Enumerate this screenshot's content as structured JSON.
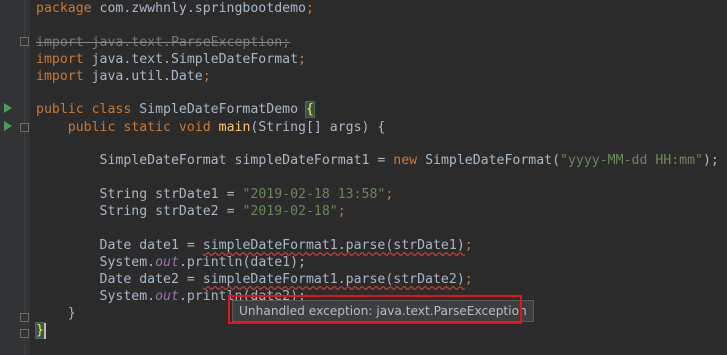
{
  "editor": {
    "lines": {
      "pkg": {
        "kw": "package",
        "name": " com.zwwhnly.springbootdemo",
        "semi": ";"
      },
      "imp1": {
        "kw": "import",
        "name": " java.text.ParseException",
        "semi": ";"
      },
      "imp2": {
        "kw": "import",
        "name": " java.text.SimpleDateFormat",
        "semi": ";"
      },
      "imp3": {
        "kw": "import",
        "name": " java.util.Date",
        "semi": ";"
      },
      "cls": {
        "kw1": "public",
        "kw2": " class ",
        "name": "SimpleDateFormatDemo ",
        "brace": "{"
      },
      "main": {
        "indent": "    ",
        "kw1": "public",
        "kw2": " static",
        "kw3": " void ",
        "fn": "main",
        "rest": "(String[] args) {"
      },
      "sdf": {
        "indent": "        ",
        "pre": "SimpleDateFormat simpleDateFormat1 = ",
        "kw": "new",
        "mid": " SimpleDateFormat(",
        "str": "\"yyyy-MM-dd HH:mm\"",
        "end": ");"
      },
      "str1": {
        "indent": "        ",
        "pre": "String strDate1 = ",
        "str": "\"2019-02-18 13:58\"",
        "end": ";"
      },
      "str2": {
        "indent": "        ",
        "pre": "String strDate2 = ",
        "str": "\"2019-02-18\"",
        "end": ";"
      },
      "d1": {
        "indent": "        ",
        "pre": "Date date1 = ",
        "err": "simpleDateFormat1.parse(strDate1)",
        "end": ";"
      },
      "p1": {
        "indent": "        ",
        "a": "System.",
        "out": "out",
        "b": ".println(date1);"
      },
      "d2": {
        "indent": "        ",
        "pre": "Date date2 = ",
        "err": "simpleDateFormat1.parse(strDate2)",
        "end": ";"
      },
      "p2": {
        "indent": "        ",
        "a": "System.",
        "out": "out",
        "b": ".println(date2);"
      },
      "close1": {
        "indent": "    ",
        "brace": "}"
      },
      "close2": {
        "brace": "}"
      }
    }
  },
  "tooltip": {
    "text": "Unhandled exception: java.text.ParseException"
  }
}
